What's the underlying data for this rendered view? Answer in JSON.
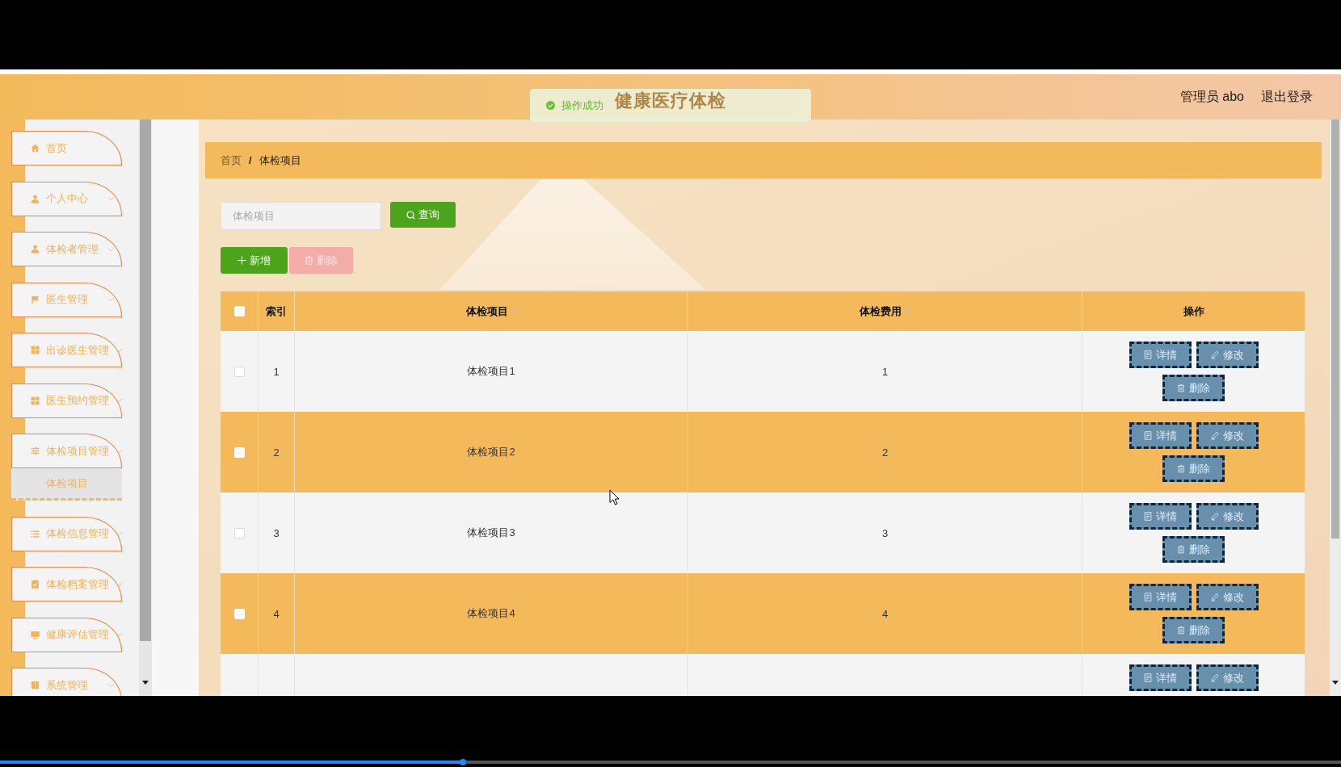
{
  "video": {
    "progress": {
      "level": 0.345
    }
  },
  "header": {
    "title": "健康医疗体检",
    "user": "管理员 abo",
    "logout": "退出登录"
  },
  "toast": {
    "kind": "success",
    "text": "操作成功"
  },
  "sidebar": {
    "items": [
      {
        "label": "首页",
        "collapsible": false,
        "selected": false
      },
      {
        "label": "个人中心",
        "collapsible": true,
        "selected": false
      },
      {
        "label": "体检者管理",
        "collapsible": true,
        "selected": false
      },
      {
        "label": "医生管理",
        "collapsible": true,
        "selected": false
      },
      {
        "label": "出诊医生管理",
        "collapsible": true,
        "selected": false
      },
      {
        "label": "医生预约管理",
        "collapsible": true,
        "selected": false
      },
      {
        "label": "体检项目管理",
        "collapsible": true,
        "selected": false,
        "children": [
          {
            "label": "体检项目",
            "selected": true
          }
        ]
      },
      {
        "label": "体检信息管理",
        "collapsible": true,
        "selected": false
      },
      {
        "label": "体检档案管理",
        "collapsible": true,
        "selected": false
      },
      {
        "label": "健康评估管理",
        "collapsible": true,
        "selected": false
      },
      {
        "label": "系统管理",
        "collapsible": true,
        "selected": false
      }
    ]
  },
  "breadcrumb": {
    "items": [
      "首页",
      "体检项目"
    ],
    "separator": "/"
  },
  "search": {
    "placeholder": "体检项目",
    "button": "查询"
  },
  "toolbar": [
    {
      "kind": "add",
      "label": "新增",
      "disabled": false
    },
    {
      "kind": "delete",
      "label": "删除",
      "disabled": true
    }
  ],
  "table": {
    "select_all": {
      "checked": false
    },
    "columns": [
      {
        "label": "索引",
        "sortable": false
      },
      {
        "label": "体检项目",
        "sortable": true
      },
      {
        "label": "体检费用",
        "sortable": true
      },
      {
        "label": "操作",
        "sortable": false
      }
    ],
    "rows": [
      {
        "checked": false,
        "cells": [
          "1",
          "体检项目1",
          "1"
        ],
        "actions": [
          {
            "kind": "detail",
            "label": "详情"
          },
          {
            "kind": "edit",
            "label": "修改"
          },
          {
            "kind": "delete",
            "label": "删除"
          }
        ]
      },
      {
        "checked": false,
        "cells": [
          "2",
          "体检项目2",
          "2"
        ],
        "actions": [
          {
            "kind": "detail",
            "label": "详情"
          },
          {
            "kind": "edit",
            "label": "修改"
          },
          {
            "kind": "delete",
            "label": "删除"
          }
        ]
      },
      {
        "checked": false,
        "cells": [
          "3",
          "体检项目3",
          "3"
        ],
        "actions": [
          {
            "kind": "detail",
            "label": "详情"
          },
          {
            "kind": "edit",
            "label": "修改"
          },
          {
            "kind": "delete",
            "label": "删除"
          }
        ]
      },
      {
        "checked": false,
        "cells": [
          "4",
          "体检项目4",
          "4"
        ],
        "actions": [
          {
            "kind": "detail",
            "label": "详情"
          },
          {
            "kind": "edit",
            "label": "修改"
          },
          {
            "kind": "delete",
            "label": "删除"
          }
        ]
      },
      {
        "actions": [
          {
            "kind": "detail",
            "label": "详情"
          },
          {
            "kind": "edit",
            "label": "修改"
          }
        ]
      }
    ]
  }
}
